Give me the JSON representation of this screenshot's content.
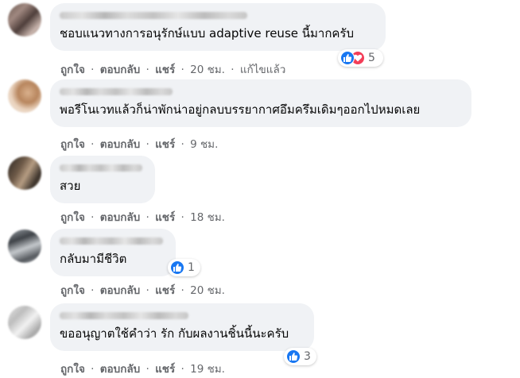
{
  "actions": {
    "like": "ถูกใจ",
    "reply": "ตอบกลับ",
    "share": "แชร์",
    "sep": "·"
  },
  "comments": [
    {
      "text": "ชอบแนวทางการอนุรักษ์แบบ adaptive reuse นี้มากครับ",
      "time": "20 ชม.",
      "edited": "แก้ไขแล้ว",
      "reaction_count": "5",
      "reactions": [
        "like-icon",
        "love-icon"
      ]
    },
    {
      "text": "พอรีโนเวทแล้วก็น่าพักน่าอยู่กลบบรรยากาศอึมครึมเดิมๆออกไปหมดเลย",
      "time": "9 ชม."
    },
    {
      "text": "สวย",
      "time": "18 ชม."
    },
    {
      "text": "กลับมามีชีวิต",
      "time": "20 ชม.",
      "reaction_count": "1",
      "reactions": [
        "like-icon"
      ]
    },
    {
      "text": "ขออนุญาตใช้คำว่า รัก กับผลงานชิ้นนี้นะครับ",
      "time": "19 ชม.",
      "reaction_count": "3",
      "reactions": [
        "like-icon"
      ]
    }
  ],
  "colors": {
    "bubble": "#f0f2f5",
    "secondary_text": "#65676b",
    "like_blue": "#1877f2",
    "love_red": "#f33e58"
  }
}
